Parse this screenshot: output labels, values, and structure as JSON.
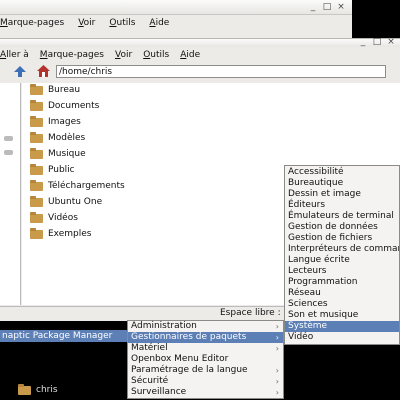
{
  "back_window": {
    "menus": [
      "Marque-pages",
      "Voir",
      "Outils",
      "Aide"
    ]
  },
  "window": {
    "controls": [
      "_",
      "□",
      "×"
    ],
    "menus": [
      "Aller à",
      "Marque-pages",
      "Voir",
      "Outils",
      "Aide"
    ],
    "path": "/home/chris",
    "files": [
      "Bureau",
      "Documents",
      "Images",
      "Modèles",
      "Musique",
      "Public",
      "Téléchargements",
      "Ubuntu One",
      "Vidéos",
      "Exemples"
    ],
    "status": "Espace libre :"
  },
  "taskbar": {
    "label": "naptic Package Manager"
  },
  "menu_main": {
    "items": [
      {
        "label": "Administration",
        "sub": true
      },
      {
        "label": "Gestionnaires de paquets",
        "sub": true
      },
      {
        "label": "Matériel",
        "sub": true
      },
      {
        "label": "Openbox Menu Editor",
        "sub": false
      },
      {
        "label": "Paramétrage de la langue",
        "sub": true
      },
      {
        "label": "Sécurité",
        "sub": true
      },
      {
        "label": "Surveillance",
        "sub": true
      }
    ]
  },
  "menu_categories": {
    "items": [
      "Accessibilité",
      "Bureautique",
      "Dessin et image",
      "Éditeurs",
      "Émulateurs de terminal",
      "Gestion de données",
      "Gestion de fichiers",
      "Interpréteurs de commandes",
      "Langue écrite",
      "Lecteurs",
      "Programmation",
      "Réseau",
      "Sciences",
      "Son et musique",
      "Système",
      "Vidéo"
    ]
  },
  "desktop": {
    "icon_label": "chris"
  }
}
